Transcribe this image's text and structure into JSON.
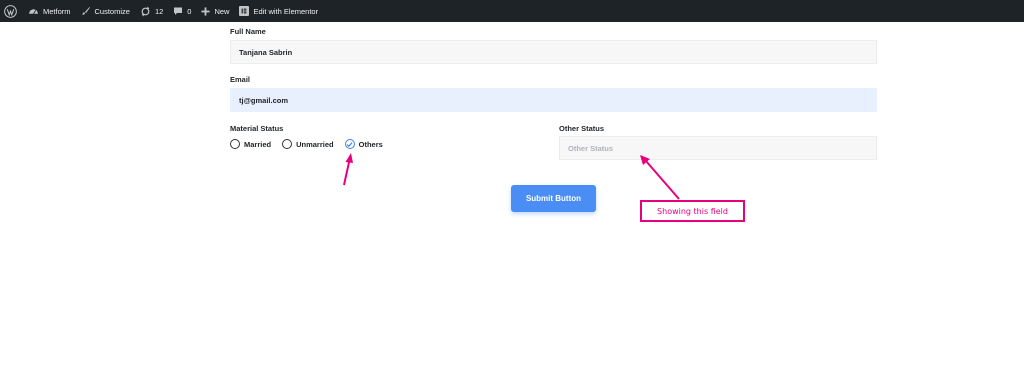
{
  "adminbar": {
    "site_name": "Metform",
    "customize": "Customize",
    "updates_count": "12",
    "comments_count": "0",
    "new": "New",
    "elementor": "Edit with Elementor"
  },
  "form": {
    "full_name": {
      "label": "Full Name",
      "value": "Tanjana Sabrin"
    },
    "email": {
      "label": "Email",
      "value": "tj@gmail.com"
    },
    "material_status": {
      "label": "Material Status",
      "options": [
        "Married",
        "Unmarried",
        "Others"
      ],
      "selected": "Others"
    },
    "other_status": {
      "label": "Other Status",
      "placeholder": "Other Status"
    },
    "submit_label": "Submit Button"
  },
  "annotation": {
    "text": "Showing this field",
    "color": "#e6007e"
  },
  "colors": {
    "accent": "#4a8ef5",
    "adminbar_bg": "#1d2327",
    "annotation": "#e6007e"
  },
  "icons": [
    "wordpress-icon",
    "dashboard-icon",
    "brush-icon",
    "updates-icon",
    "comment-icon",
    "plus-icon",
    "elementor-icon"
  ]
}
